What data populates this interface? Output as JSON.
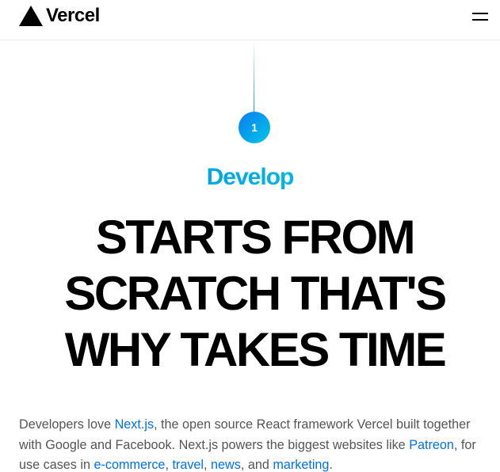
{
  "header": {
    "brand": "Vercel",
    "menu_icon": "hamburger-menu-icon"
  },
  "step": {
    "number": "1",
    "title": "Develop"
  },
  "headline": {
    "line1": "STARTS FROM",
    "line2": "SCRATCH THAT'S",
    "line3": "WHY TAKES TIME"
  },
  "description": {
    "t1": "Developers love ",
    "link_nextjs": "Next.js",
    "t2": ", the open source React framework Vercel built together with Google and Facebook. Next.js powers the biggest websites like ",
    "link_patreon": "Patreon",
    "t3": ", for use cases in ",
    "link_ecommerce": "e-commerce",
    "t4": ", ",
    "link_travel": "travel",
    "t5": ", ",
    "link_news": "news",
    "t6": ", and ",
    "link_marketing": "marketing",
    "t7": "."
  },
  "colors": {
    "link": "#0070f3",
    "gradient_start": "#007cf0",
    "gradient_end": "#00dfd8",
    "body_text": "#555555"
  }
}
